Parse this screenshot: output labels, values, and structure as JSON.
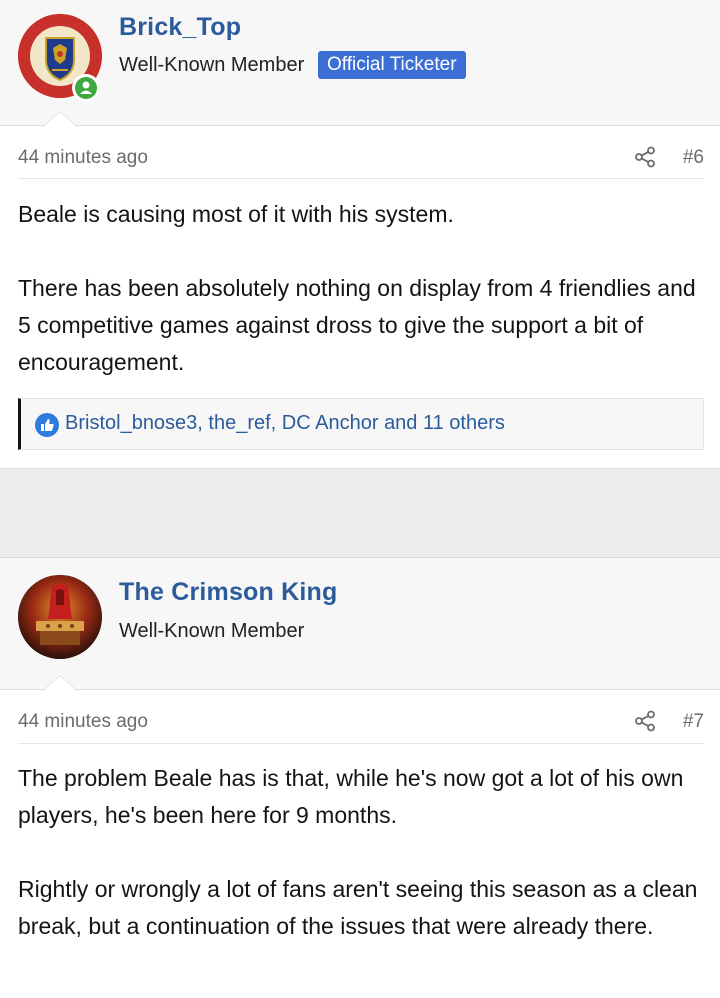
{
  "posts": [
    {
      "username": "Brick_Top",
      "user_title": "Well-Known Member",
      "badge": "Official Ticketer",
      "avatar_icon": "rangers-crest-avatar",
      "online": true,
      "time": "44 minutes ago",
      "post_number": "#6",
      "paragraphs": [
        "Beale is causing most of it with his system.",
        "There has been absolutely nothing on display from 4 friendlies and 5 competitive games against dross to give the support a bit of encouragement."
      ],
      "reactions": "Bristol_bnose3, the_ref, DC Anchor and 11 others"
    },
    {
      "username": "The Crimson King",
      "user_title": "Well-Known Member",
      "avatar_icon": "crimson-king-avatar",
      "time": "44 minutes ago",
      "post_number": "#7",
      "paragraphs": [
        "The problem Beale has is that, while he's now got a lot of his own players, he's been here for 9 months.",
        "Rightly or wrongly a lot of fans aren't seeing this season as a clean break, but a continuation of the issues that were already there."
      ]
    }
  ],
  "colors": {
    "link": "#2c5b9b",
    "badge": "#3b6fd6",
    "online": "#3fa83f",
    "like": "#2e7bdc"
  }
}
